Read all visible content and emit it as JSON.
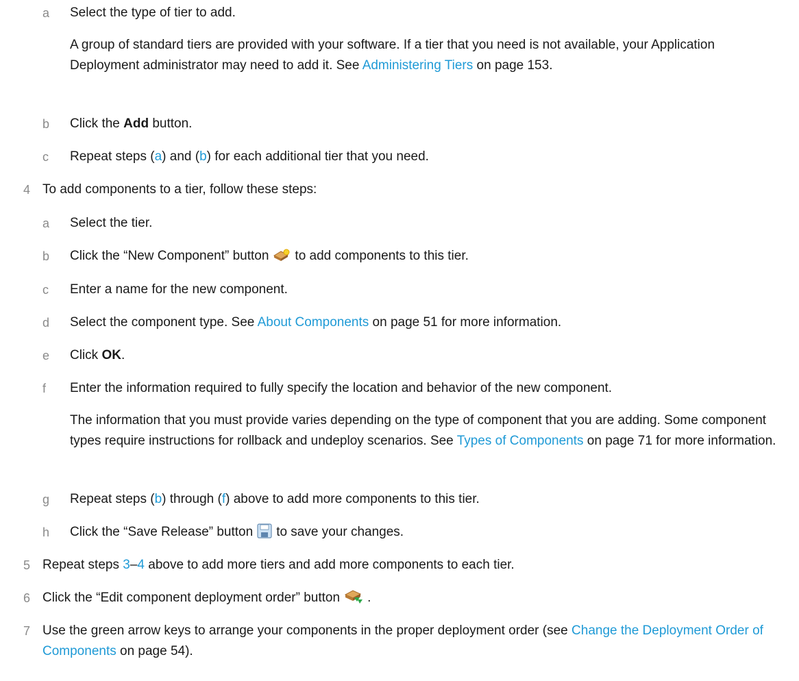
{
  "a1": {
    "label": "a",
    "text": "Select the type of tier to add."
  },
  "a1_note": {
    "pre": "A group of standard tiers are provided with your software. If a tier that you need is not available, your Application Deployment administrator may need to add it. See ",
    "link": "Administering Tiers",
    "post": " on page 153."
  },
  "b1": {
    "label": "b",
    "pre": "Click the ",
    "bold": "Add",
    "post": " button."
  },
  "c1": {
    "label": "c",
    "pre": "Repeat steps (",
    "link_a": "a",
    "mid": ") and (",
    "link_b": "b",
    "post": ") for each additional tier that you need."
  },
  "s4": {
    "label": "4",
    "text": "To add components to a tier, follow these steps:"
  },
  "a2": {
    "label": "a",
    "text": "Select the tier."
  },
  "b2": {
    "label": "b",
    "pre": "Click the “New Component” button",
    "post": "to add components to this tier.",
    "icon": "new-component-icon"
  },
  "c2": {
    "label": "c",
    "text": "Enter a name for the new component."
  },
  "d2": {
    "label": "d",
    "pre": "Select the component type. See ",
    "link": "About Components",
    "post": " on page 51 for more information."
  },
  "e2": {
    "label": "e",
    "pre": "Click ",
    "bold": "OK",
    "post": "."
  },
  "f2": {
    "label": "f",
    "text": "Enter the information required to fully specify the location and behavior of the new component."
  },
  "f2_note": {
    "pre": "The information that you must provide varies depending on the type of component that you are adding. Some component types require instructions for rollback and undeploy scenarios. See ",
    "link": "Types of Components",
    "post": " on page 71 for more information."
  },
  "g2": {
    "label": "g",
    "pre": "Repeat steps (",
    "link_b": "b",
    "mid": ") through (",
    "link_f": "f",
    "post": ") above to add more components to this tier."
  },
  "h2": {
    "label": "h",
    "pre": "Click the “Save Release” button",
    "post": "to save your changes.",
    "icon": "save-icon"
  },
  "s5": {
    "label": "5",
    "pre": "Repeat steps ",
    "link_3": "3",
    "dash": "–",
    "link_4": "4",
    "post": " above to add more tiers and add more components to each tier."
  },
  "s6": {
    "label": "6",
    "pre": "Click the “Edit component deployment order” button",
    "post": ".",
    "icon": "deployment-order-icon"
  },
  "s7": {
    "label": "7",
    "pre": "Use the green arrow keys to arrange your components in the proper deployment order (see ",
    "link": "Change the Deployment Order of Components",
    "post": " on page 54)."
  },
  "colors": {
    "link": "#1f9ad6",
    "number": "#8a8a8a",
    "text": "#1a1a1a"
  }
}
